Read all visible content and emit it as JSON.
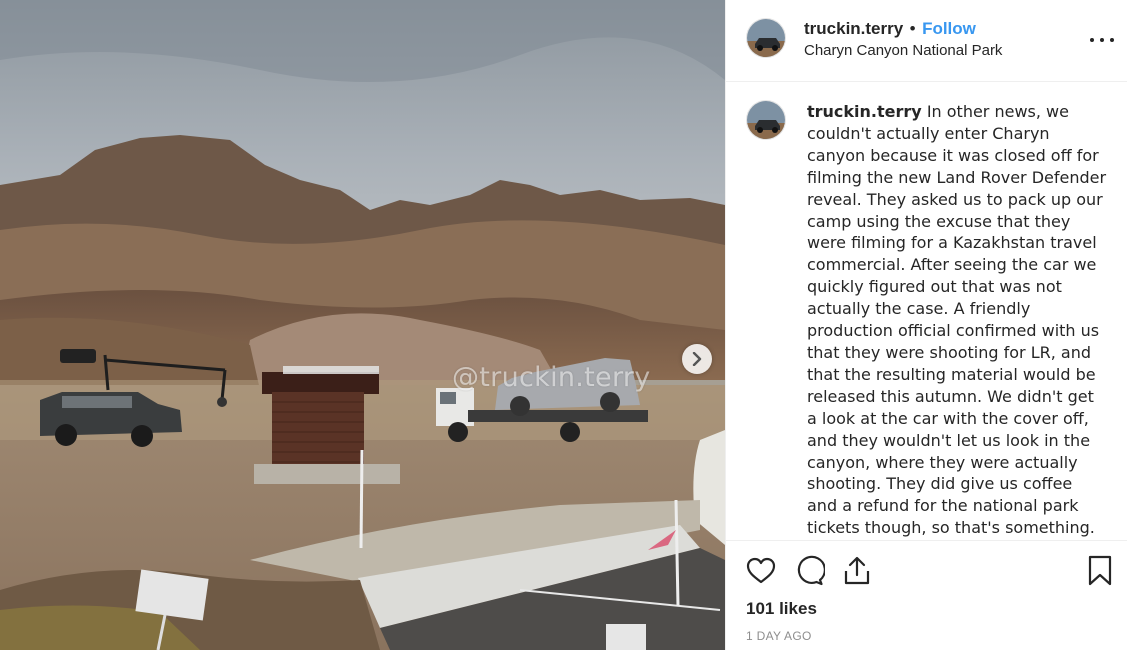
{
  "photo": {
    "watermark": "@truckin.terry",
    "next_icon": "chevron-right-icon"
  },
  "header": {
    "username": "truckin.terry",
    "separator": "•",
    "follow_label": "Follow",
    "location": "Charyn Canyon National Park",
    "more_icon": "more-options-icon"
  },
  "caption": {
    "username": "truckin.terry",
    "text": "In other news, we couldn't actually enter Charyn canyon because it was closed off for filming the new Land Rover Defender reveal. They asked us to pack up our camp using the excuse that they were filming for a Kazakhstan travel commercial. After seeing the car we quickly figured out that was not actually the case. A friendly production official confirmed with us that they were shooting for LR, and that the resulting material would be released this autumn. We didn't get a look at the car with the cover off, and they wouldn't let us look in the canyon, where they were actually shooting. They did give us coffee and a refund for the national park tickets though, so that's something."
  },
  "actions": {
    "like_icon": "heart-icon",
    "comment_icon": "comment-icon",
    "share_icon": "share-icon",
    "save_icon": "bookmark-icon"
  },
  "likes": "101 likes",
  "timestamp": "1 DAY AGO",
  "colors": {
    "follow": "#3897f0",
    "text": "#262626",
    "muted": "#8e8e8e",
    "divider": "#efefef"
  }
}
